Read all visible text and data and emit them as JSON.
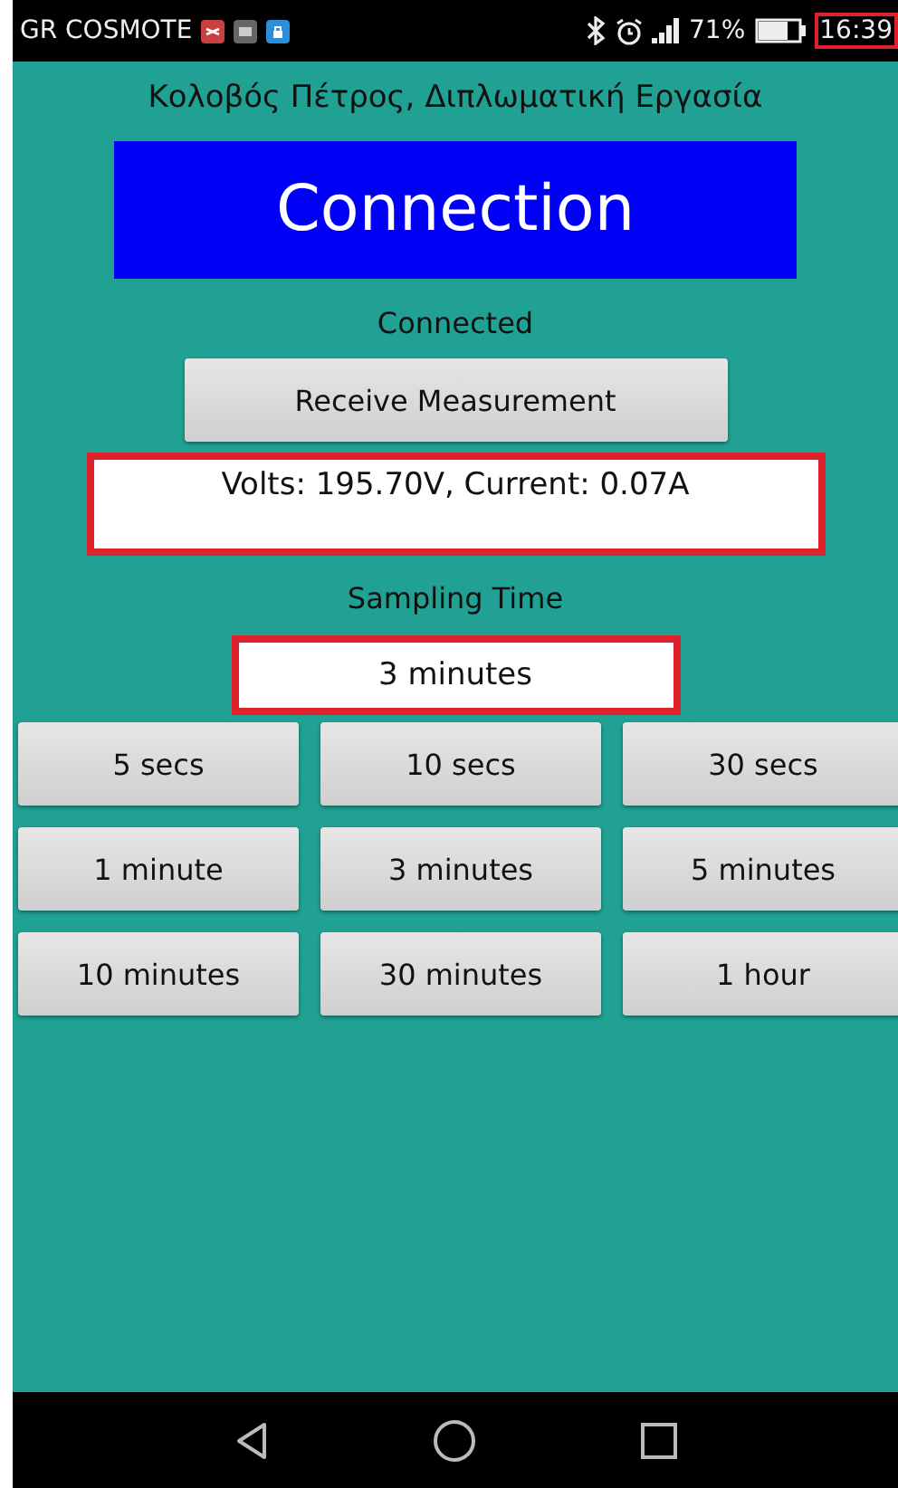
{
  "status_bar": {
    "carrier": "GR COSMOTE",
    "battery": "71%",
    "time": "16:39",
    "time_highlighted": true
  },
  "title": "Κολοβός Πέτρος, Διπλωματική Εργασία",
  "connection_button": "Connection",
  "connection_status": "Connected",
  "receive_button": "Receive Measurement",
  "reading": {
    "value": "Volts: 195.70V, Current: 0.07A",
    "highlighted": true
  },
  "sampling": {
    "label": "Sampling Time",
    "value": "3 minutes",
    "highlighted": true
  },
  "interval_buttons": [
    {
      "label": "5 secs"
    },
    {
      "label": "10 secs"
    },
    {
      "label": "30 secs"
    },
    {
      "label": "1 minute"
    },
    {
      "label": "3 minutes"
    },
    {
      "label": "5 minutes"
    },
    {
      "label": "10 minutes"
    },
    {
      "label": "30 minutes"
    },
    {
      "label": "1 hour"
    }
  ]
}
